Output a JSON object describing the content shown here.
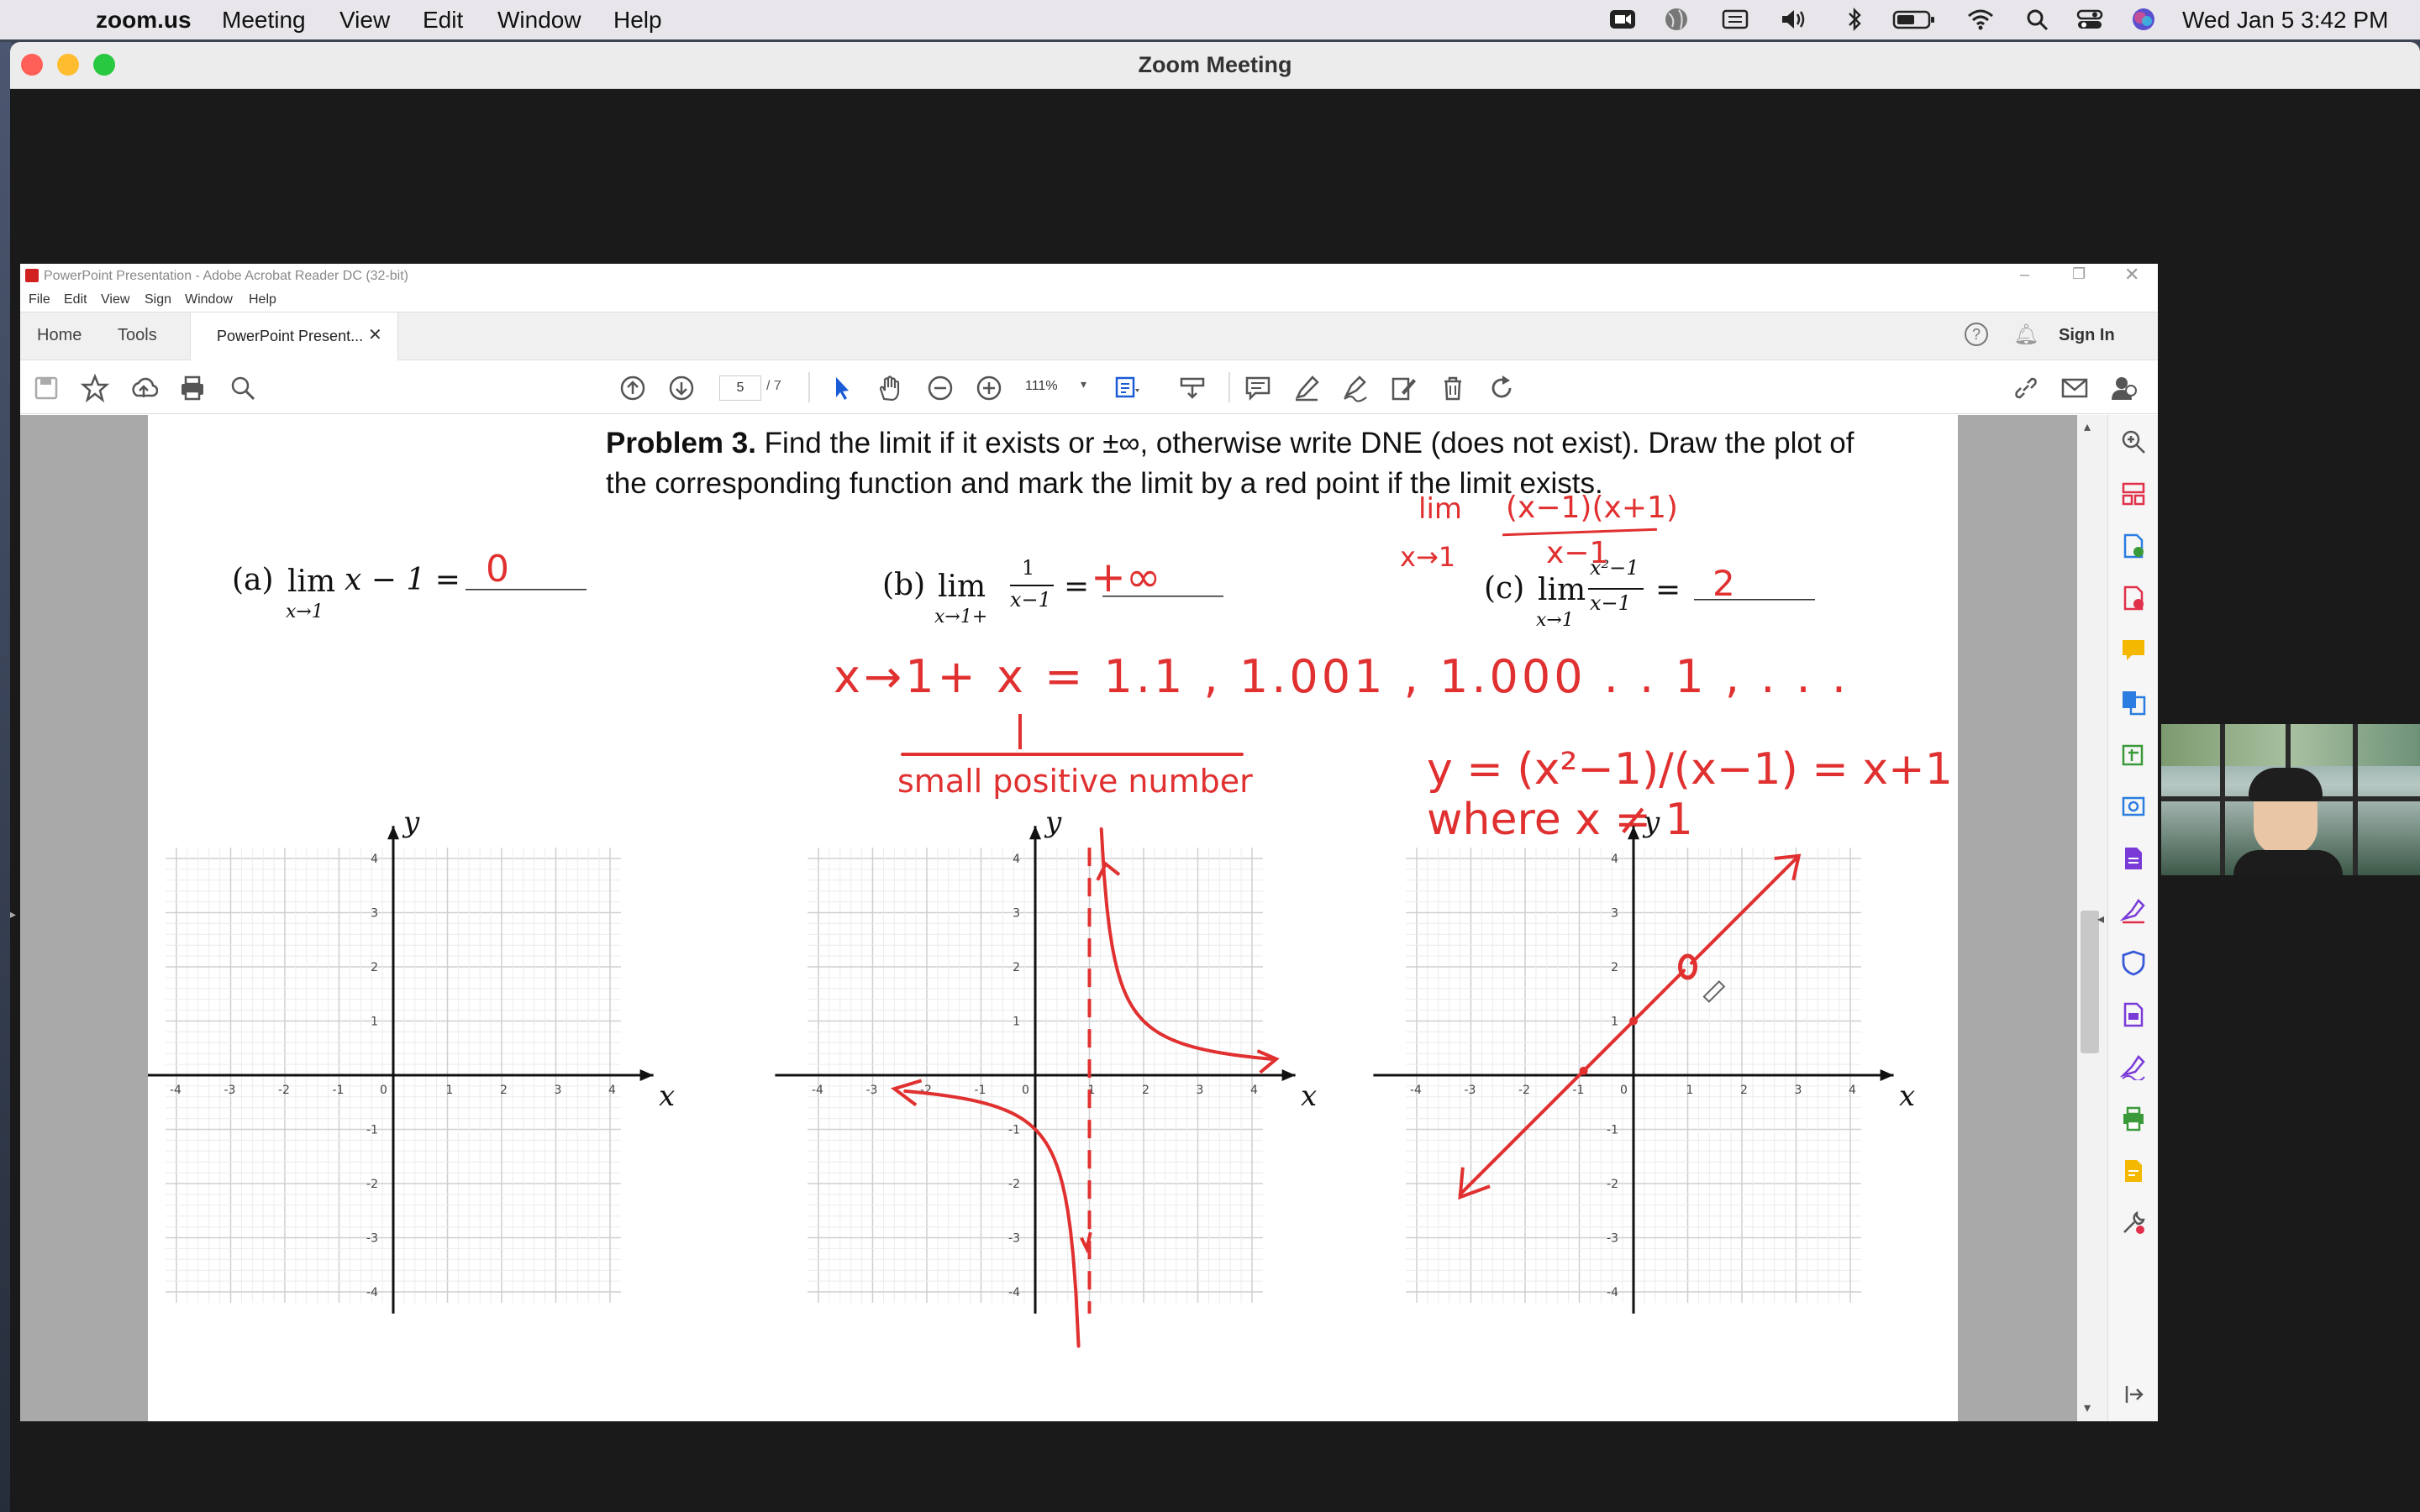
{
  "menubar": {
    "app": "zoom.us",
    "items": [
      "Meeting",
      "View",
      "Edit",
      "Window",
      "Help"
    ],
    "clock": "Wed Jan 5  3:42 PM"
  },
  "zoom": {
    "title": "Zoom Meeting"
  },
  "acrobat": {
    "title": "PowerPoint Presentation - Adobe Acrobat Reader DC (32-bit)",
    "menu": [
      "File",
      "Edit",
      "View",
      "Sign",
      "Window",
      "Help"
    ],
    "tabs": {
      "home": "Home",
      "tools": "Tools",
      "doc": "PowerPoint Present..."
    },
    "sign_in": "Sign In",
    "page_current": "5",
    "page_total": "/ 7",
    "zoom": "111%"
  },
  "doc": {
    "problem_label": "Problem 3.",
    "problem_text1": " Find the limit if it exists or ±∞, otherwise write DNE (does not exist). Draw the plot of",
    "problem_text2": "the corresponding function and mark the limit by a red point if the limit exists.",
    "a_label": "(a)",
    "a_expr": "x − 1 =",
    "a_lim": "lim",
    "a_sub": "x→1",
    "b_label": "(b)",
    "b_lim": "lim",
    "b_sub": "x→1+",
    "b_num": "1",
    "b_den": "x−1",
    "b_eq": "=",
    "c_label": "(c)",
    "c_lim": "lim",
    "c_sub": "x→1",
    "c_num": "x²−1",
    "c_den": "x−1",
    "c_eq": "=",
    "blank": "________"
  },
  "handwriting": {
    "a_answer": "0",
    "b_answer": "+∞",
    "c_answer": "2",
    "note_lim": "lim",
    "note_sub": "x→1",
    "note_num": "(x−1)(x+1)",
    "note_den": "x−1",
    "seq": "x→1+    x = 1.1 , 1.001 , 1.000 . . 1 ,  . . .",
    "small": "small positive number",
    "func": "y = (x²−1)/(x−1) = x+1  where  x ≠ 1"
  },
  "graph": {
    "ticks": [
      "-4",
      "-3",
      "-2",
      "-1",
      "0",
      "1",
      "2",
      "3",
      "4"
    ],
    "xlabel": "x",
    "ylabel": "y"
  },
  "colors": {
    "ink": "#e03030",
    "mac_red": "#ff5f57",
    "mac_yellow": "#febc2e",
    "mac_green": "#28c840"
  }
}
